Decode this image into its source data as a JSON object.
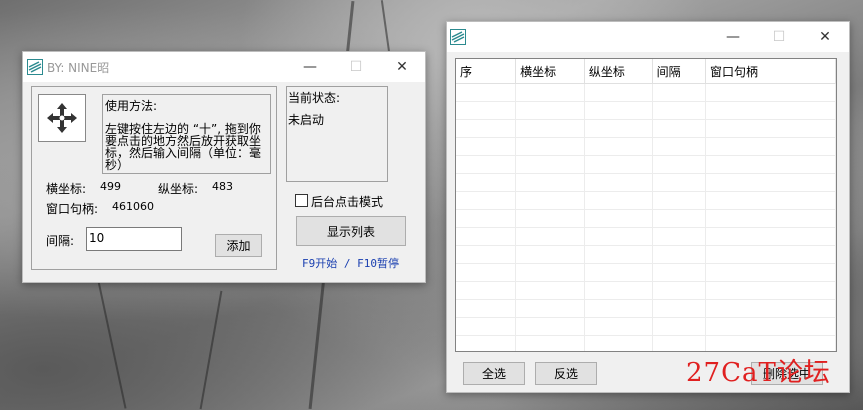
{
  "main_window": {
    "title": "BY: NINE昭",
    "usage_title": "使用方法:",
    "usage_text": "左键按住左边的 “十”, 拖到你要点击的地方然后放开获取坐标，然后输入间隔（单位：毫秒）",
    "status_title": "当前状态:",
    "status_value": "未启动",
    "x_label": "横坐标:",
    "x_value": "499",
    "y_label": "纵坐标:",
    "y_value": "483",
    "handle_label": "窗口句柄:",
    "handle_value": "461060",
    "interval_label": "间隔:",
    "interval_value": "10",
    "add_button": "添加",
    "background_mode_label": "后台点击模式",
    "show_list_button": "显示列表",
    "hotkey_hint": "F9开始 / F10暂停"
  },
  "list_window": {
    "columns": [
      "序",
      "横坐标",
      "纵坐标",
      "间隔",
      "窗口句柄"
    ],
    "select_all_button": "全选",
    "invert_button": "反选",
    "delete_button": "删除选中"
  },
  "watermark": "27CaT论坛",
  "colors": {
    "accent": "#2b78d6",
    "hotkey_text": "#1a3fb0",
    "watermark": "#e02020"
  },
  "icons": {
    "app": "app-logo-icon",
    "minimize": "minimize-icon",
    "maximize": "maximize-icon",
    "close": "close-icon",
    "crosshair": "crosshair-icon"
  }
}
